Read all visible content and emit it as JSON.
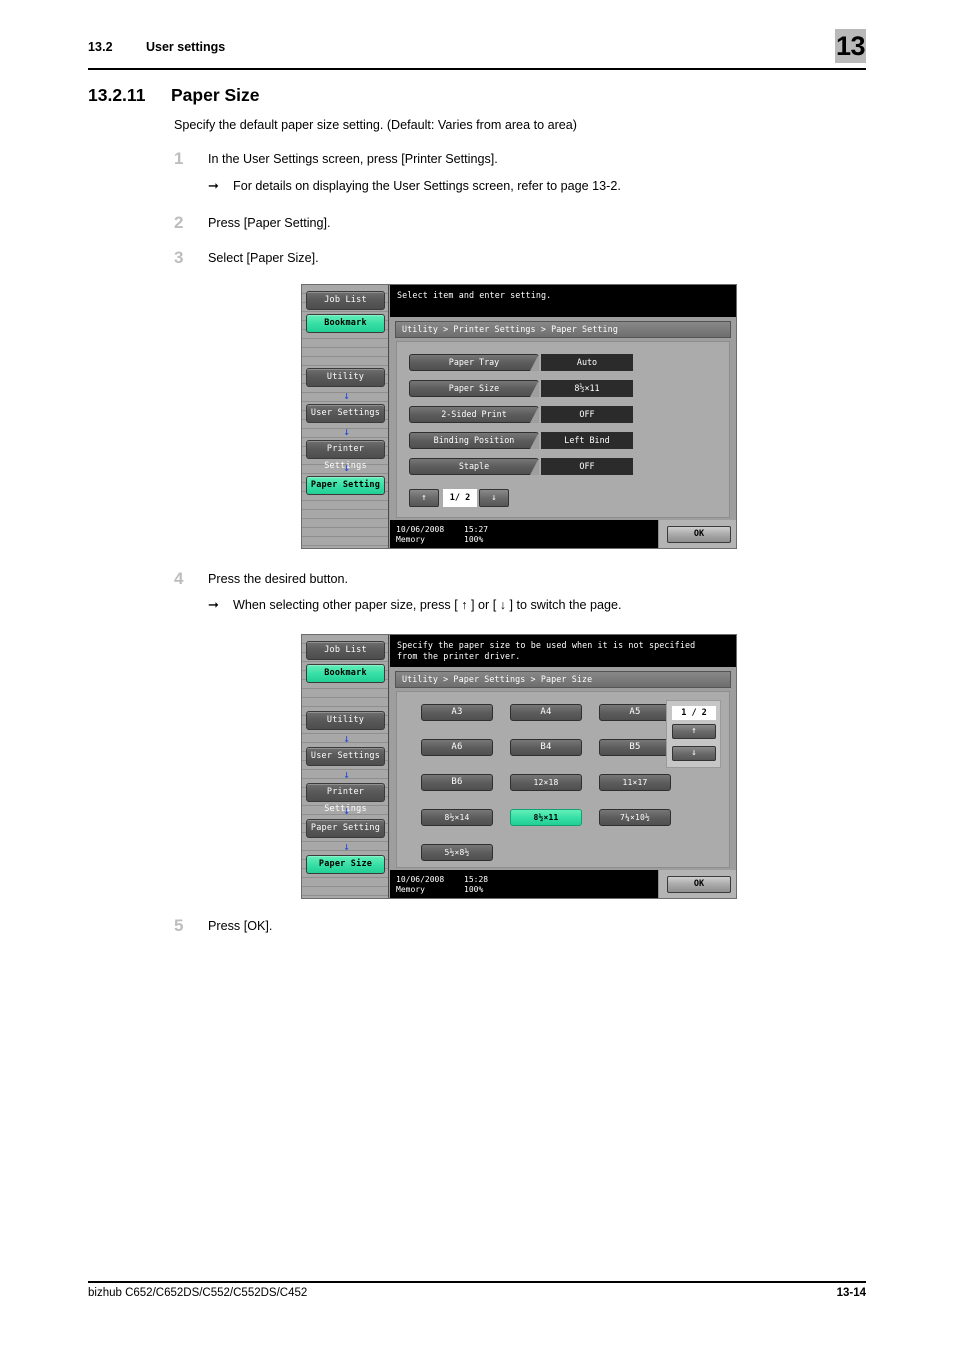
{
  "header": {
    "section_number": "13.2",
    "section_title": "User settings",
    "chapter_badge": "13"
  },
  "heading": {
    "number": "13.2.11",
    "title": "Paper Size"
  },
  "intro": "Specify the default paper size setting. (Default: Varies from area to area)",
  "steps": [
    {
      "num": "1",
      "text": "In the User Settings screen, press [Printer Settings].",
      "sub": "For details on displaying the User Settings screen, refer to page 13-2."
    },
    {
      "num": "2",
      "text": "Press [Paper Setting]."
    },
    {
      "num": "3",
      "text": "Select [Paper Size]."
    },
    {
      "num": "4",
      "text": "Press the desired button.",
      "sub": "When selecting other paper size, press [ ↑ ] or [ ↓ ] to switch the page."
    },
    {
      "num": "5",
      "text": "Press [OK]."
    }
  ],
  "panel1": {
    "sidebar": [
      {
        "label": "Job List",
        "style": "dark"
      },
      {
        "label": "Bookmark",
        "style": "green"
      },
      {
        "label": "Utility",
        "style": "dark"
      },
      {
        "label": "User Settings",
        "style": "dark"
      },
      {
        "label": "Printer Settings",
        "style": "dark"
      },
      {
        "label": "Paper Setting",
        "style": "green"
      }
    ],
    "message": "Select item and enter setting.",
    "message_line2": "",
    "breadcrumb": "Utility > Printer Settings > Paper Setting",
    "settings": [
      {
        "name": "Paper Tray",
        "value": "Auto"
      },
      {
        "name": "Paper Size",
        "value": "8½×11"
      },
      {
        "name": "2-Sided Print",
        "value": "OFF"
      },
      {
        "name": "Binding Position",
        "value": "Left Bind"
      },
      {
        "name": "Staple",
        "value": "OFF"
      }
    ],
    "pager": {
      "up": "↑",
      "page": "1/ 2",
      "down": "↓"
    },
    "status": {
      "date": "10/06/2008",
      "time": "15:27",
      "memory_label": "Memory",
      "memory_value": "100%"
    },
    "ok_label": "OK"
  },
  "panel2": {
    "sidebar": [
      {
        "label": "Job List",
        "style": "dark"
      },
      {
        "label": "Bookmark",
        "style": "green"
      },
      {
        "label": "Utility",
        "style": "dark"
      },
      {
        "label": "User Settings",
        "style": "dark"
      },
      {
        "label": "Printer Settings",
        "style": "dark"
      },
      {
        "label": "Paper Setting",
        "style": "dark"
      },
      {
        "label": "Paper Size",
        "style": "green"
      }
    ],
    "message": "Specify the paper size to be used when it is not specified",
    "message_line2": "from the printer driver.",
    "breadcrumb": "Utility > Paper Settings > Paper Size",
    "sizes": [
      {
        "label": "A3",
        "selected": false,
        "small": false
      },
      {
        "label": "A4",
        "selected": false,
        "small": false
      },
      {
        "label": "A5",
        "selected": false,
        "small": false
      },
      {
        "label": "A6",
        "selected": false,
        "small": false
      },
      {
        "label": "B4",
        "selected": false,
        "small": false
      },
      {
        "label": "B5",
        "selected": false,
        "small": false
      },
      {
        "label": "B6",
        "selected": false,
        "small": false
      },
      {
        "label": "12×18",
        "selected": false,
        "small": true
      },
      {
        "label": "11×17",
        "selected": false,
        "small": true
      },
      {
        "label": "8½×14",
        "selected": false,
        "small": true
      },
      {
        "label": "8½×11",
        "selected": true,
        "small": true
      },
      {
        "label": "7¼×10½",
        "selected": false,
        "small": true
      },
      {
        "label": "5½×8½",
        "selected": false,
        "small": true
      }
    ],
    "pager": {
      "page": "1 / 2",
      "up": "↑",
      "down": "↓"
    },
    "status": {
      "date": "10/06/2008",
      "time": "15:28",
      "memory_label": "Memory",
      "memory_value": "100%"
    },
    "ok_label": "OK"
  },
  "footer": {
    "models": "bizhub C652/C652DS/C552/C552DS/C452",
    "page": "13-14"
  }
}
